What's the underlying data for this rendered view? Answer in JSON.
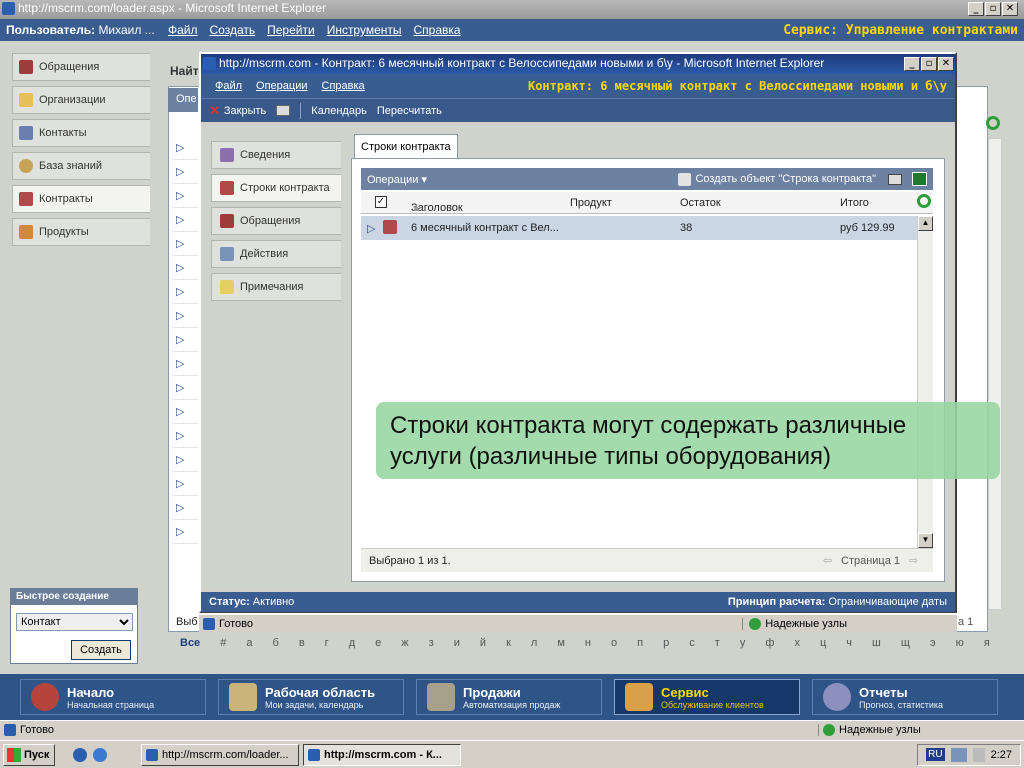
{
  "browser": {
    "title": "http://mscrm.com/loader.aspx - Microsoft Internet Explorer",
    "status": "Готово",
    "zone": "Надежные узлы"
  },
  "app": {
    "user_label": "Пользователь:",
    "user_name": "Михаил ...",
    "menu": [
      "Файл",
      "Создать",
      "Перейти",
      "Инструменты",
      "Справка"
    ],
    "area_title": "Сервис: Управление контрактами"
  },
  "nav": {
    "items": [
      {
        "label": "Обращения",
        "icon": "case-icon"
      },
      {
        "label": "Организации",
        "icon": "folder-icon"
      },
      {
        "label": "Контакты",
        "icon": "contact-icon"
      },
      {
        "label": "База знаний",
        "icon": "search-icon"
      },
      {
        "label": "Контракты",
        "icon": "contract-icon",
        "active": true
      },
      {
        "label": "Продукты",
        "icon": "product-icon"
      }
    ]
  },
  "quick_create": {
    "title": "Быстрое создание",
    "selected": "Контакт",
    "button": "Создать"
  },
  "background_list": {
    "find_label": "Найт",
    "ops_label": "Опе",
    "footer_left": "Выб",
    "page_right": "а 1",
    "alphabet": [
      "Все",
      "#",
      "а",
      "б",
      "в",
      "г",
      "д",
      "е",
      "ж",
      "з",
      "и",
      "й",
      "к",
      "л",
      "м",
      "н",
      "о",
      "п",
      "р",
      "с",
      "т",
      "у",
      "ф",
      "х",
      "ц",
      "ч",
      "ш",
      "щ",
      "э",
      "ю",
      "я"
    ]
  },
  "popup": {
    "title": "http://mscrm.com - Контракт: 6 месячный контракт с Велоссипедами новыми и б\\у - Microsoft Internet Explorer",
    "menu": [
      "Файл",
      "Операции",
      "Справка"
    ],
    "record_title": "Контракт: 6 месячный контракт с Велоссипедами новыми и б\\у",
    "toolbar": {
      "close": "Закрыть",
      "calendar": "Календарь",
      "recalc": "Пересчитать"
    },
    "nav": [
      {
        "label": "Сведения",
        "icon": "info-icon"
      },
      {
        "label": "Строки контракта",
        "icon": "contract-lines-icon",
        "active": true
      },
      {
        "label": "Обращения",
        "icon": "case-icon"
      },
      {
        "label": "Действия",
        "icon": "activity-icon"
      },
      {
        "label": "Примечания",
        "icon": "notes-icon"
      }
    ],
    "tab": "Строки контракта",
    "grid": {
      "ops_label": "Операции",
      "create_label": "Создать объект \"Строка контракта\"",
      "columns": [
        "Заголовок",
        "Продукт",
        "Остаток",
        "Итого"
      ],
      "rows": [
        {
          "title": "6 месячный контракт с Вел...",
          "product": "",
          "remaining": "38",
          "total": "руб 129.99"
        }
      ],
      "footer_selected": "Выбрано 1 из 1.",
      "footer_page": "Страница 1"
    },
    "status_label": "Статус:",
    "status_value": "Активно",
    "pricing_label": "Принцип расчета:",
    "pricing_value": "Ограничивающие даты",
    "ie_status": "Готово",
    "ie_zone": "Надежные узлы"
  },
  "callout": {
    "line1": "Строки контракта могут содержать различные",
    "line2": "услуги (различные типы оборудования)"
  },
  "taskpanel": [
    {
      "title": "Начало",
      "subtitle": "Начальная страница"
    },
    {
      "title": "Рабочая область",
      "subtitle": "Мои задачи, календарь"
    },
    {
      "title": "Продажи",
      "subtitle": "Автоматизация продаж"
    },
    {
      "title": "Сервис",
      "subtitle": "Обслуживание клиентов",
      "active": true
    },
    {
      "title": "Отчеты",
      "subtitle": "Прогноз, статистика"
    }
  ],
  "taskbar": {
    "start": "Пуск",
    "tasks": [
      "http://mscrm.com/loader...",
      "http://mscrm.com - К..."
    ],
    "lang": "RU",
    "clock": "2:27"
  }
}
